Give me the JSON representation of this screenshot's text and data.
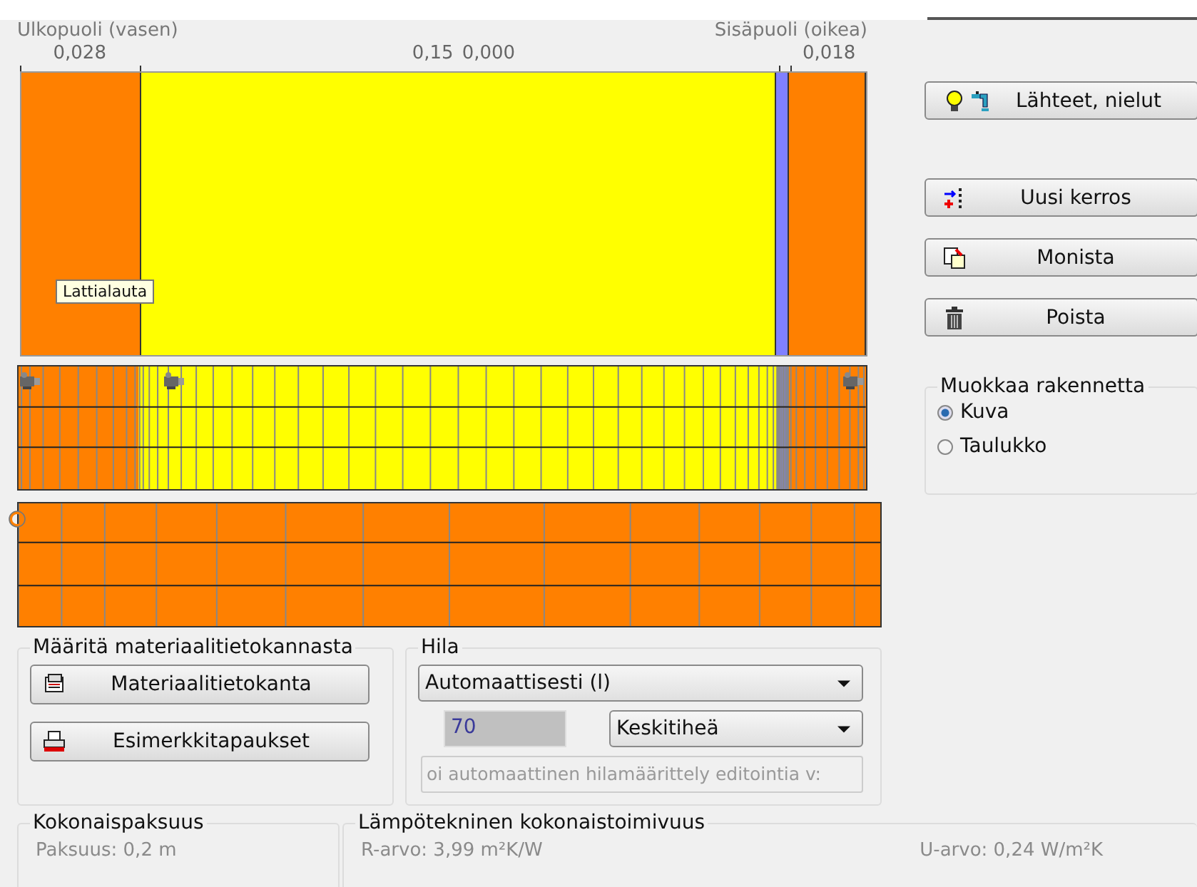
{
  "scale": {
    "left_label": "Ulkopuoli (vasen)",
    "right_label": "Sisäpuoli (oikea)"
  },
  "layers": [
    {
      "thickness": "0,028",
      "color": "#ff8000"
    },
    {
      "thickness": "0,15",
      "color": "#ffff00"
    },
    {
      "thickness": "0,000",
      "color": "#8080ff"
    },
    {
      "thickness": "0,018",
      "color": "#ff8000"
    }
  ],
  "tooltip": "Lattialauta",
  "side_buttons": [
    {
      "label": "Lähteet, nielut",
      "kind": "sources"
    },
    {
      "label": "Uusi kerros",
      "kind": "new-layer"
    },
    {
      "label": "Monista",
      "kind": "copy"
    },
    {
      "label": "Poista",
      "kind": "delete"
    }
  ],
  "edit_group": {
    "title": "Muokkaa rakennetta",
    "options": [
      {
        "label": "Kuva",
        "selected": true
      },
      {
        "label": "Taulukko",
        "selected": false
      }
    ]
  },
  "material_group": {
    "title": "Määritä materiaalitietokannasta",
    "buttons": [
      {
        "label": "Materiaalitietokanta",
        "kind": "database"
      },
      {
        "label": "Esimerkkitapaukset",
        "kind": "examples"
      }
    ]
  },
  "grid_group": {
    "title": "Hila",
    "mode": "Automaattisesti (l)",
    "count": "70",
    "density": "Keskitiheä",
    "note": "oi automaattinen hilamäärittely editointia v:"
  },
  "thickness_group": {
    "title": "Kokonaispaksuus",
    "value": "Paksuus: 0,2 m"
  },
  "performance_group": {
    "title": "Lämpötekninen kokonaistoimivuus",
    "r_value": "R-arvo: 3,99 m²K/W",
    "u_value": "U-arvo: 0,24 W/m²K"
  }
}
